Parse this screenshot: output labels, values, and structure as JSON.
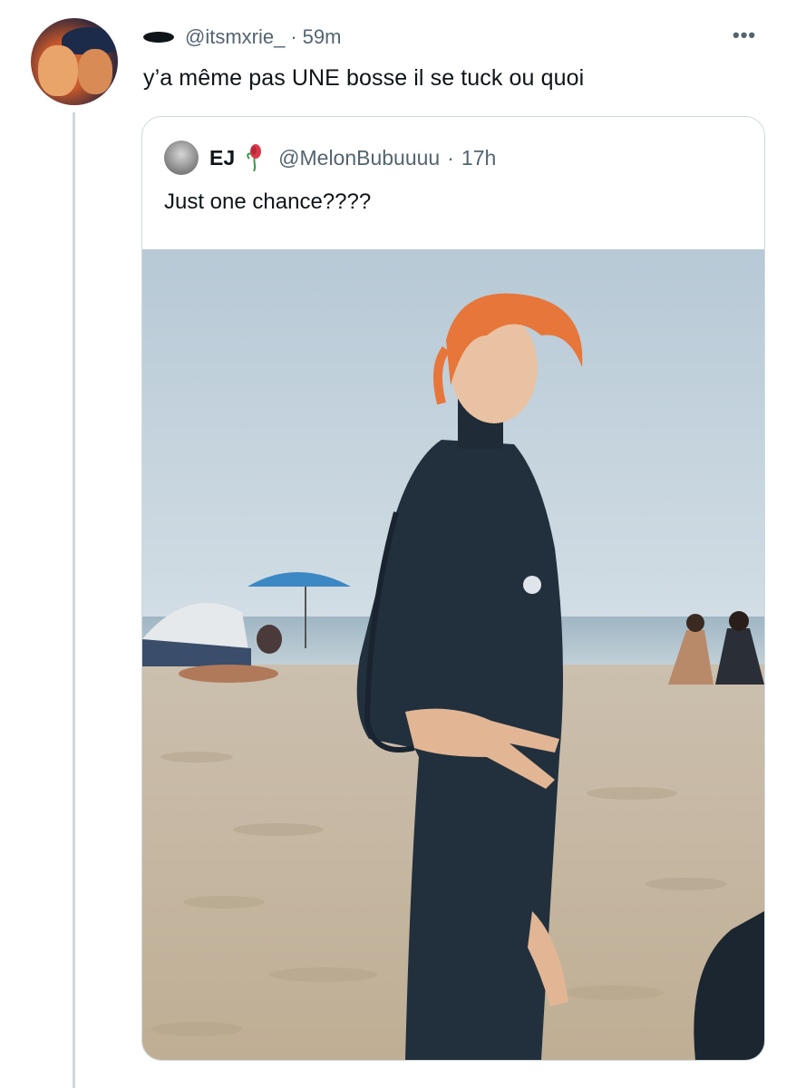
{
  "tweet": {
    "handle": "@itsmxrie_",
    "separator": "·",
    "time": "59m",
    "text": "y’a même pas UNE bosse il se tuck ou quoi",
    "more_icon": "more-dots-icon",
    "more_label": "•••"
  },
  "quoted": {
    "name": "EJ",
    "handle": "@MelonBubuuuu",
    "separator": "·",
    "time": "17h",
    "text": "Just one chance????",
    "photo_description_icon": "beach-photo"
  },
  "colors": {
    "text_primary": "#0f1419",
    "text_secondary": "#536471",
    "border": "#cfd9de"
  }
}
